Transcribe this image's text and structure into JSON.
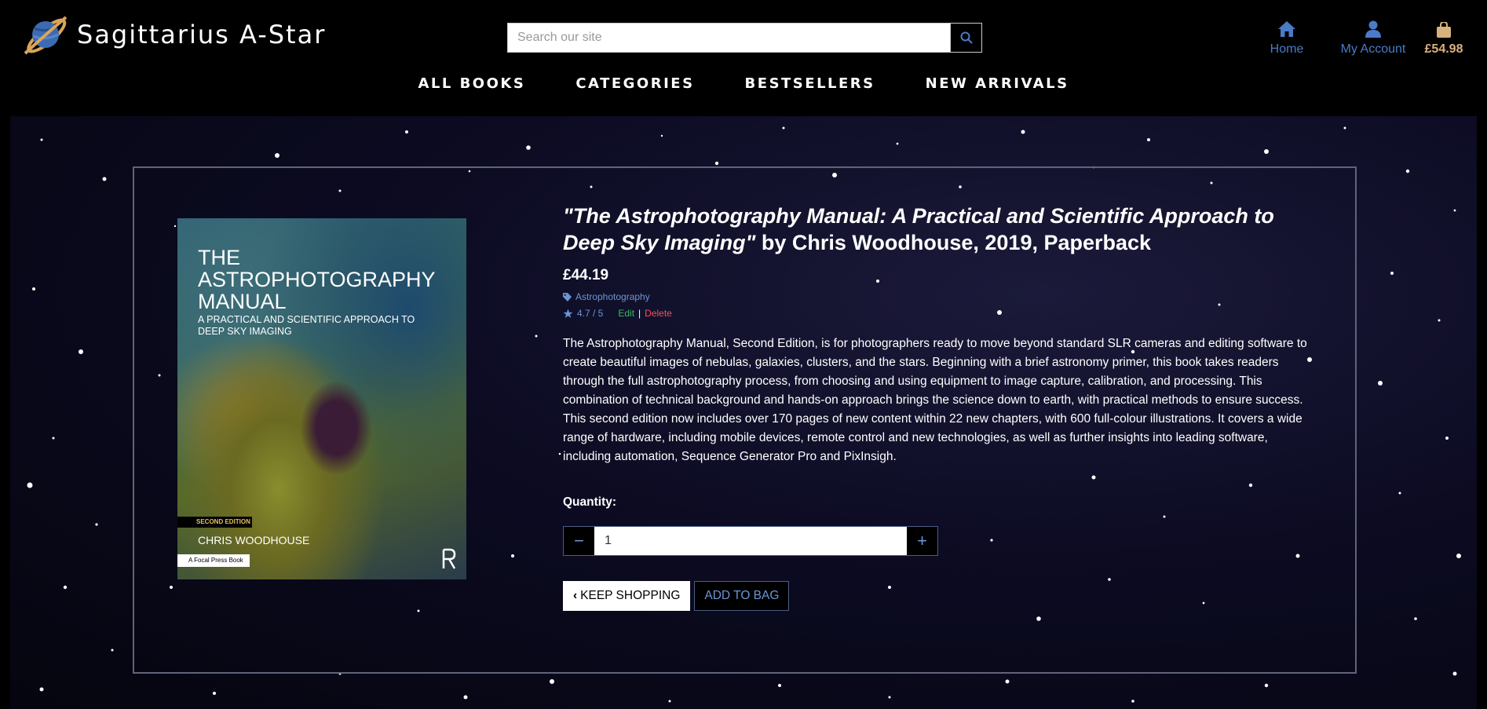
{
  "brand": {
    "name": "Sagittarius A-Star",
    "logo_icon": "ringed-planet-icon"
  },
  "search": {
    "placeholder": "Search our site",
    "icon": "search-icon"
  },
  "top_links": {
    "home": {
      "label": "Home",
      "icon": "home-icon"
    },
    "account": {
      "label": "My Account",
      "icon": "user-icon"
    },
    "bag": {
      "label": "£54.98",
      "icon": "shopping-bag-icon"
    }
  },
  "main_nav": [
    "ALL BOOKS",
    "CATEGORIES",
    "BESTSELLERS",
    "NEW ARRIVALS"
  ],
  "colors": {
    "accent": "#4a7bc6",
    "bag_total": "#d9b17d",
    "edit": "#34b86a",
    "delete": "#ff4b5a",
    "panel_border": "#5f6478"
  },
  "product": {
    "cover": {
      "title_line": "THE ASTROPHOTOGRAPHY MANUAL",
      "subtitle_line": "A PRACTICAL AND SCIENTIFIC APPROACH TO DEEP SKY IMAGING",
      "edition": "SECOND EDITION",
      "author": "CHRIS WOODHOUSE",
      "publisher": "A Focal Press Book"
    },
    "title_italic": "\"The Astrophotography Manual: A Practical and Scientific Approach to Deep Sky Imaging\"",
    "title_rest": " by Chris Woodhouse, 2019, Paperback",
    "price": "£44.19",
    "category": "Astrophotography",
    "rating": "4.7 / 5",
    "edit_label": "Edit",
    "separator": "|",
    "delete_label": "Delete",
    "description": "The Astrophotography Manual, Second Edition, is for photographers ready to move beyond standard SLR cameras and editing software to create beautiful images of nebulas, galaxies, clusters, and the stars. Beginning with a brief astronomy primer, this book takes readers through the full astrophotography process, from choosing and using equipment to image capture, calibration, and processing. This combination of technical background and hands-on approach brings the science down to earth, with practical methods to ensure success. This second edition now includes over 170 pages of new content within 22 new chapters, with 600 full-colour illustrations. It covers a wide range of hardware, including mobile devices, remote control and new technologies, as well as further insights into leading software, including automation, Sequence Generator Pro and PixInsigh."
  },
  "quantity": {
    "label": "Quantity:",
    "value": "1",
    "minus": "−",
    "plus": "+"
  },
  "buttons": {
    "keep_shopping": "KEEP SHOPPING",
    "add_to_bag": "ADD TO BAG"
  }
}
